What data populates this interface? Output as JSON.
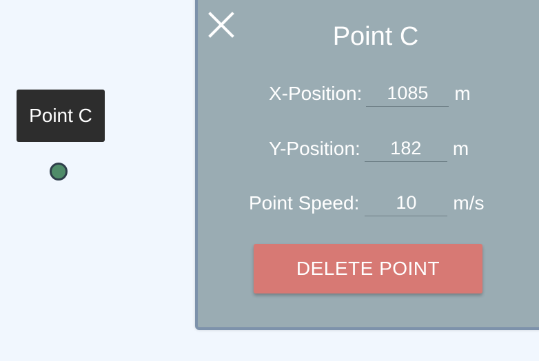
{
  "map": {
    "point_label": "Point C",
    "point_color": "#4f8c69"
  },
  "panel": {
    "close_icon": "close-x-icon",
    "title": "Point C",
    "fields": [
      {
        "label": "X-Position:",
        "value": "1085",
        "unit": "m"
      },
      {
        "label": "Y-Position:",
        "value": "182",
        "unit": "m"
      },
      {
        "label": "Point Speed:",
        "value": "10",
        "unit": "m/s"
      }
    ],
    "delete_label": "DELETE POINT",
    "delete_color": "#d77974"
  }
}
